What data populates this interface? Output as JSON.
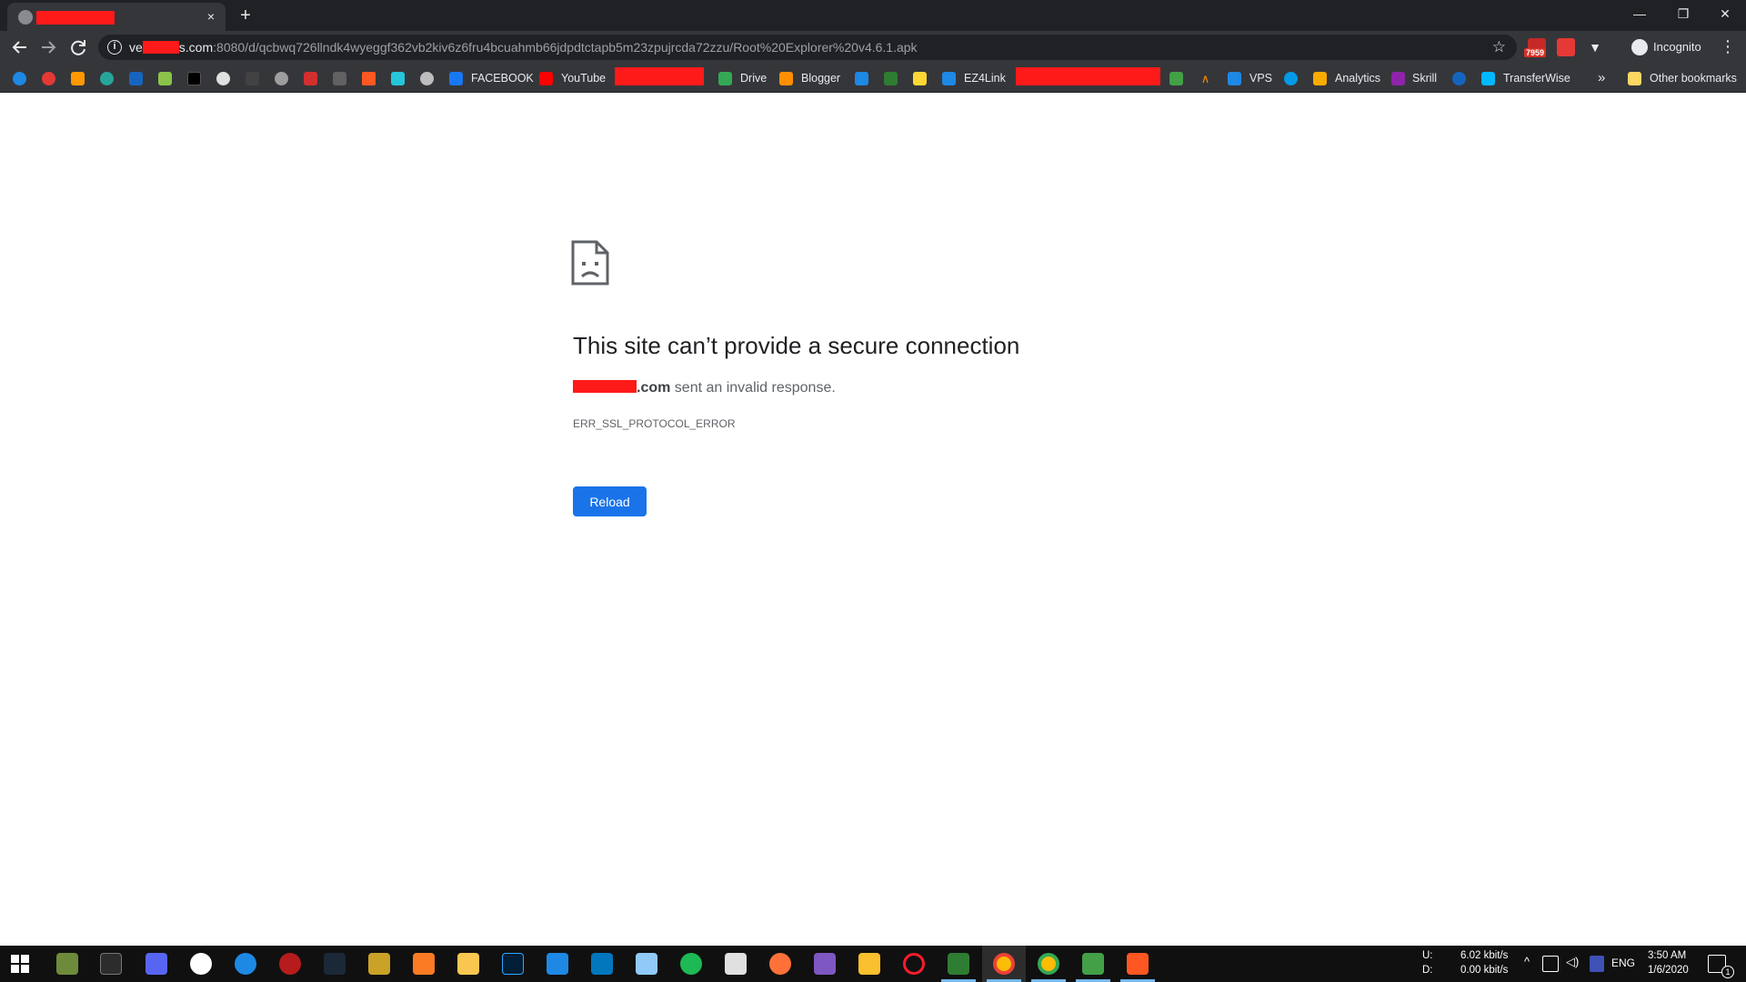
{
  "browser": {
    "tab": {
      "close_glyph": "×"
    },
    "new_tab_glyph": "+",
    "window_buttons": {
      "minimize": "—",
      "restore": "❐",
      "close": "✕"
    },
    "address": {
      "host_start": "ve",
      "host_end": "s.com",
      "path": ":8080/d/qcbwq726llndk4wyeggf362vb2kiv6z6fru4bcuahmb66jdpdtctapb5m23zpujrcda72zzu/Root%20Explorer%20v4.6.1.apk"
    },
    "extension_badge": "7959",
    "incognito_label": "Incognito",
    "bookmarks": {
      "facebook": "FACEBOOK",
      "youtube": "YouTube",
      "drive": "Drive",
      "blogger": "Blogger",
      "ez4link": "EZ4Link",
      "vps": "VPS",
      "analytics": "Analytics",
      "skrill": "Skrill",
      "transferwise": "TransferWise",
      "overflow": "»",
      "other": "Other bookmarks"
    }
  },
  "error_page": {
    "title": "This site can’t provide a secure connection",
    "host_suffix": ".com",
    "description": " sent an invalid response.",
    "code": "ERR_SSL_PROTOCOL_ERROR",
    "reload_label": "Reload"
  },
  "taskbar": {
    "net_up_label": "U:",
    "net_down_label": "D:",
    "net_up": "6.02 kbit/s",
    "net_down": "0.00 kbit/s",
    "lang": "ENG",
    "time": "3:50 AM",
    "date": "1/6/2020",
    "notification_count": "1"
  },
  "colors": {
    "accent": "#1a73e8",
    "chrome_dark": "#202124",
    "chrome_toolbar": "#35363a",
    "redaction": "#ff1a1a"
  }
}
